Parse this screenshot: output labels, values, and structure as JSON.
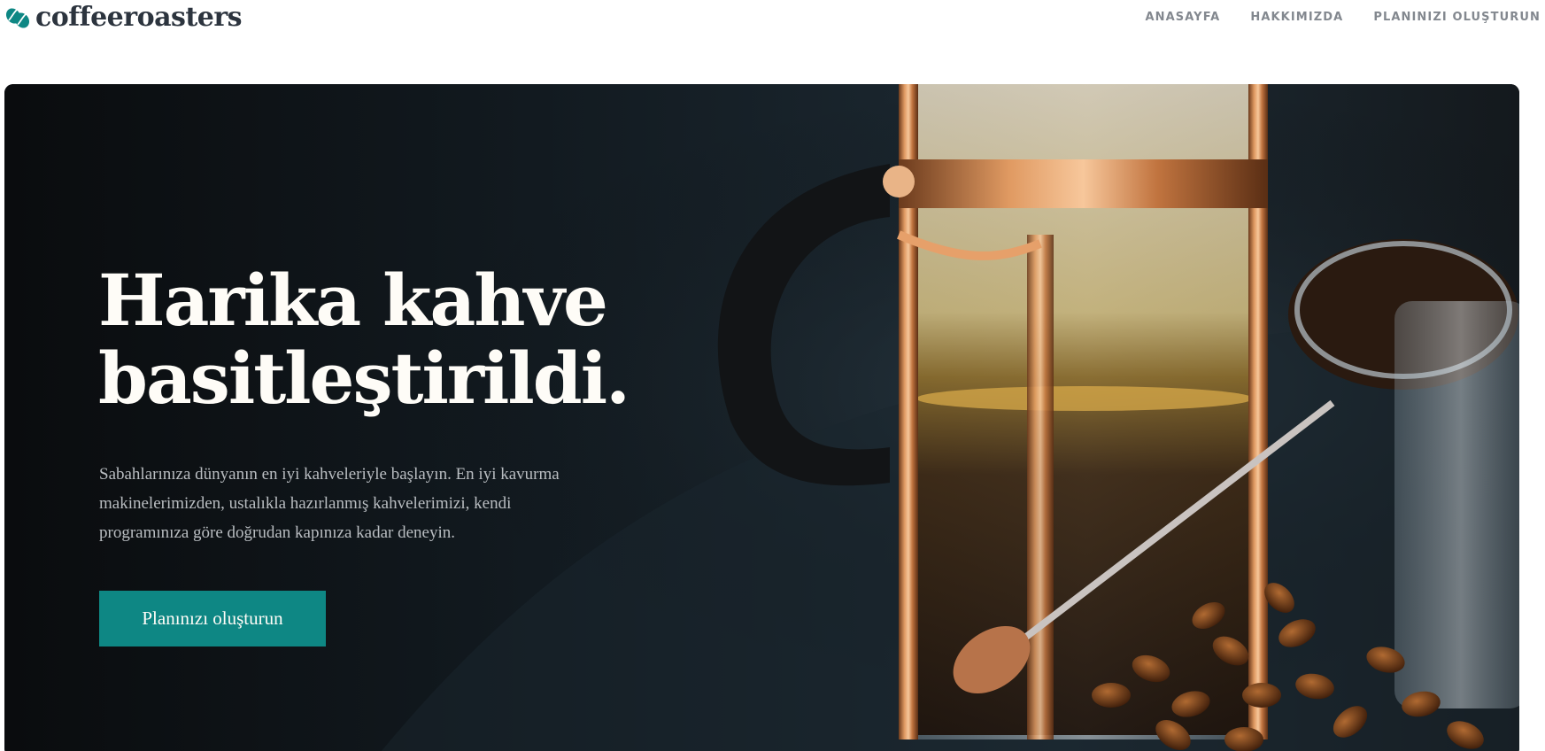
{
  "brand": {
    "name": "coffeeroasters",
    "logo_icon": "coffee-bean-icon",
    "accent_color": "#0e8784"
  },
  "nav": {
    "items": [
      {
        "label": "ANASAYFA"
      },
      {
        "label": "HAKKIMIZDA"
      },
      {
        "label": "PLANINIZI OLUŞTURUN"
      }
    ]
  },
  "hero": {
    "title": "Harika kahve basitleştirildi.",
    "description": "Sabahlarınıza dünyanın en iyi kahveleriyle başlayın. En iyi kavurma makinelerimizden, ustalıkla hazırlanmış kahvelerimizi, kendi programınıza göre doğrudan kapınıza kadar deneyin.",
    "button_label": "Planınızı oluşturun",
    "background_image": "french-press-coffee-photo"
  }
}
